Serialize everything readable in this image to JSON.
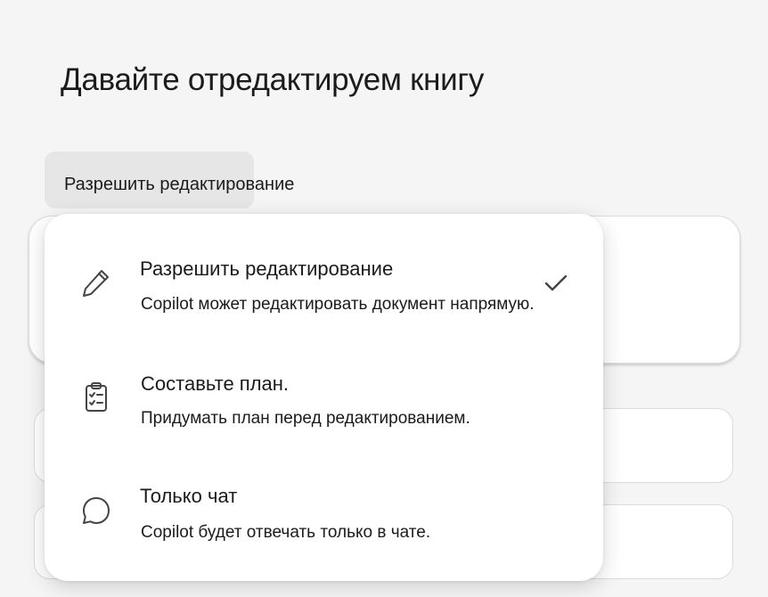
{
  "page": {
    "title": "Давайте отредактируем книгу"
  },
  "mode_button": {
    "label": "Разрешить редактирование"
  },
  "menu": {
    "items": [
      {
        "title": "Разрешить редактирование",
        "description": "Copilot может редактировать документ напрямую.",
        "icon": "pencil-icon",
        "selected": true
      },
      {
        "title": "Составьте план.",
        "description": "Придумать план перед редактированием.",
        "icon": "clipboard-checklist-icon",
        "selected": false
      },
      {
        "title": "Только чат",
        "description": "Copilot будет отвечать только в чате.",
        "icon": "chat-bubble-icon",
        "selected": false
      }
    ]
  },
  "colors": {
    "background": "#f5f5f5",
    "menu_background": "#ffffff",
    "button_background": "#e6e6e6",
    "text": "#1b1b1b",
    "icon": "#444444"
  }
}
